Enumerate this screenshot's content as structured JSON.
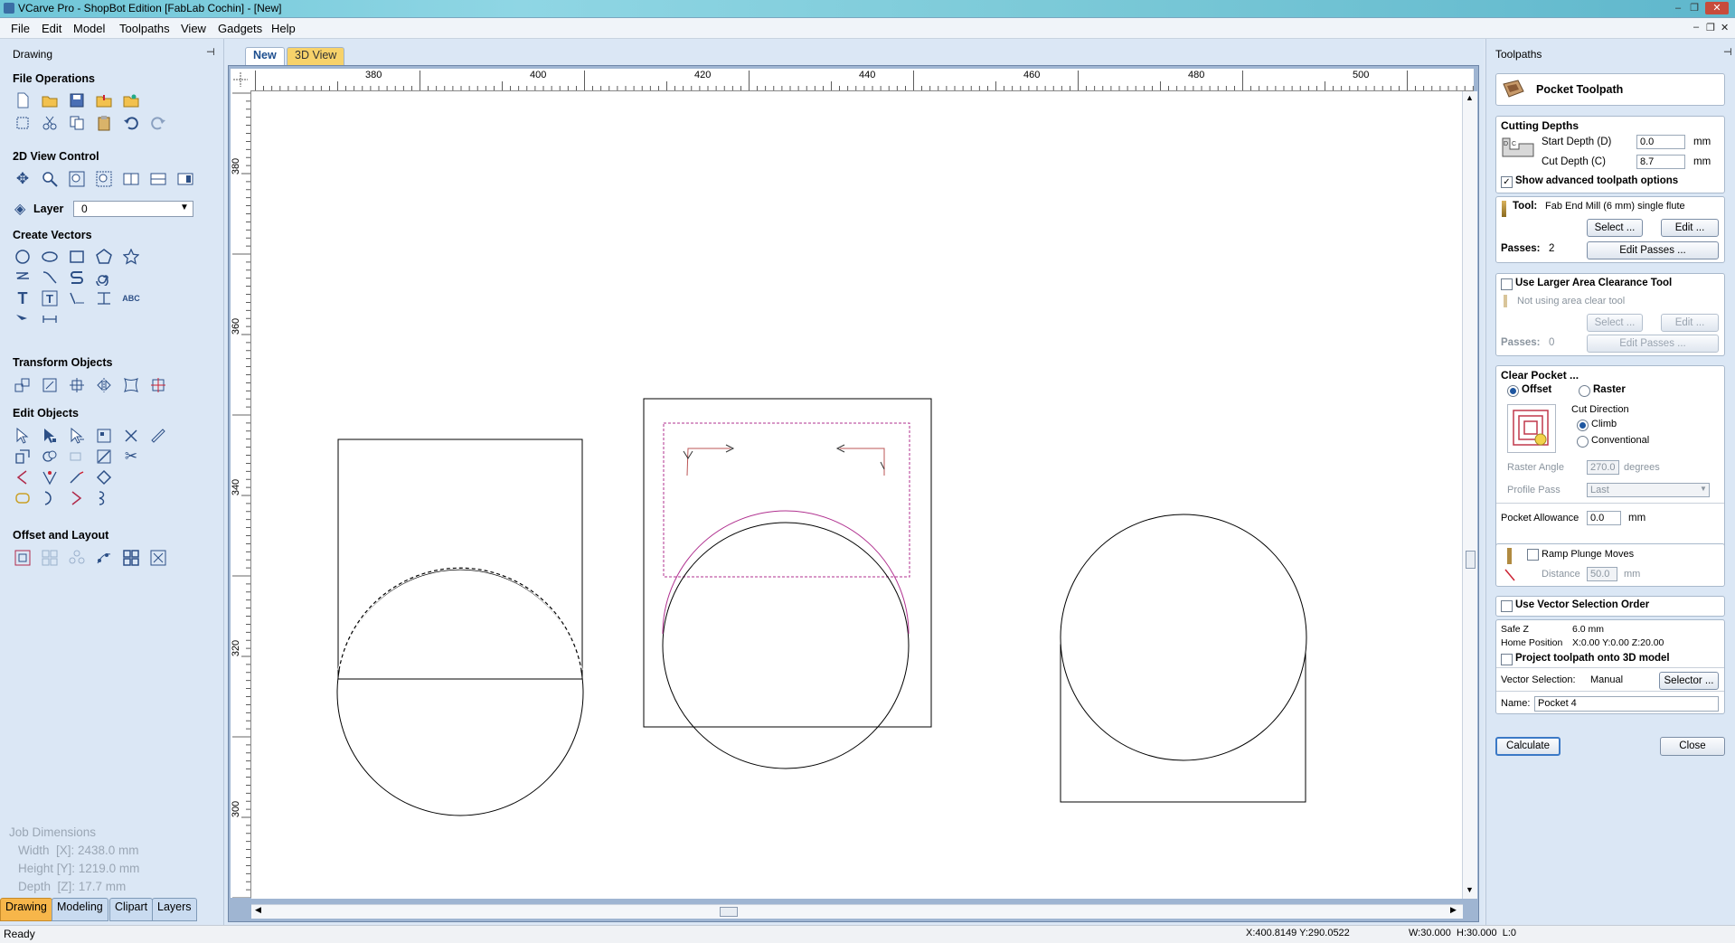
{
  "window": {
    "title": "VCarve Pro - ShopBot Edition [FabLab Cochin] - [New]",
    "controls": [
      "–",
      "❐",
      "✕"
    ]
  },
  "menu": [
    "File",
    "Edit",
    "Model",
    "Toolpaths",
    "View",
    "Gadgets",
    "Help"
  ],
  "mdi_controls": [
    "–",
    "❐",
    "✕"
  ],
  "left_panel": {
    "title": "Drawing",
    "pin": "⊣",
    "sections": {
      "file_ops": "File Operations",
      "view_control": "2D View Control",
      "create_vectors": "Create Vectors",
      "transform": "Transform Objects",
      "edit_objects": "Edit Objects",
      "offset_layout": "Offset and Layout"
    },
    "layer": {
      "label": "Layer",
      "value": "0"
    },
    "job_dimensions": {
      "title": "Job Dimensions",
      "width": "Width  [X]: 2438.0 mm",
      "height": "Height [Y]: 1219.0 mm",
      "depth": "Depth  [Z]: 17.7 mm"
    },
    "bottom_tabs": [
      "Drawing",
      "Modeling",
      "Clipart",
      "Layers"
    ]
  },
  "doc_tabs": [
    "New",
    "3D View"
  ],
  "rulers": {
    "top_labels": [
      "380",
      "400",
      "420",
      "440",
      "460",
      "480",
      "500"
    ],
    "left_labels": [
      "380",
      "360",
      "340",
      "320",
      "300"
    ]
  },
  "right_panel": {
    "title": "Toolpaths",
    "pin": "⊣",
    "header": "Pocket Toolpath",
    "cutting_depths": {
      "title": "Cutting Depths",
      "start_label": "Start Depth (D)",
      "start_value": "0.0",
      "cut_label": "Cut Depth (C)",
      "cut_value": "8.7",
      "unit": "mm"
    },
    "advanced": {
      "label": "Show advanced toolpath options",
      "checked": true
    },
    "tool": {
      "label": "Tool:",
      "name": "Fab End Mill (6 mm) single flute",
      "select": "Select ...",
      "edit": "Edit ...",
      "passes_label": "Passes:",
      "passes_value": "2",
      "edit_passes": "Edit Passes ..."
    },
    "area_clear": {
      "label": "Use Larger Area Clearance Tool",
      "checked": false,
      "note": "Not using area clear tool",
      "select": "Select ...",
      "edit": "Edit ...",
      "passes_label": "Passes:",
      "passes_value": "0",
      "edit_passes": "Edit Passes ..."
    },
    "clear_pocket": {
      "title": "Clear Pocket ...",
      "offset": "Offset",
      "raster": "Raster",
      "selected": "offset",
      "cut_direction": "Cut Direction",
      "climb": "Climb",
      "conventional": "Conventional",
      "direction": "climb",
      "raster_angle_label": "Raster Angle",
      "raster_angle_value": "270.0",
      "raster_angle_unit": "degrees",
      "profile_pass_label": "Profile Pass",
      "profile_pass_value": "Last"
    },
    "pocket_allowance": {
      "label": "Pocket Allowance",
      "value": "0.0",
      "unit": "mm"
    },
    "ramp": {
      "label": "Ramp Plunge Moves",
      "checked": false,
      "distance_label": "Distance",
      "distance_value": "50.0",
      "unit": "mm"
    },
    "vector_order": {
      "label": "Use Vector Selection Order",
      "checked": false
    },
    "safe_z": {
      "label": "Safe Z",
      "value": "6.0 mm"
    },
    "home": {
      "label": "Home Position",
      "value": "X:0.00 Y:0.00 Z:20.00"
    },
    "project": {
      "label": "Project toolpath onto 3D model",
      "checked": false
    },
    "vector_selection": {
      "label": "Vector Selection:",
      "value": "Manual",
      "button": "Selector ..."
    },
    "name": {
      "label": "Name:",
      "value": "Pocket 4"
    },
    "calculate": "Calculate",
    "close": "Close"
  },
  "status": {
    "left": "Ready",
    "coords": "X:400.8149 Y:290.0522",
    "size": "W:30.000  H:30.000  L:0"
  },
  "colors": {
    "panel_bg": "#dbe7f5",
    "toolpath_preview": "#b0308f",
    "tool_icon": "#2c4f86"
  }
}
